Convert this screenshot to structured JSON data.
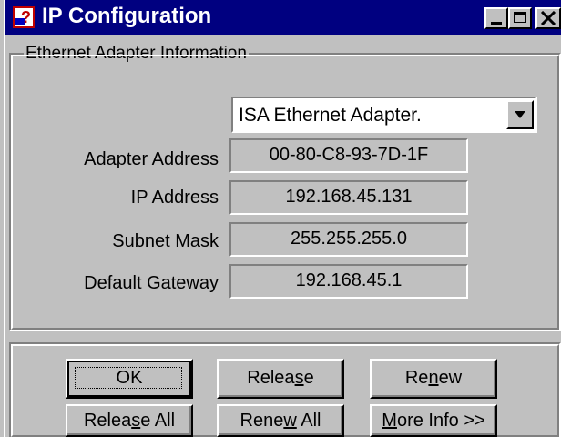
{
  "window": {
    "title": "IP Configuration",
    "icon": "ip-config-app-icon",
    "controls": {
      "minimize": "minimize-icon",
      "maximize": "maximize-icon",
      "close": "close-icon"
    }
  },
  "adapter_group": {
    "legend": "Ethernet  Adapter Information",
    "adapter_select": {
      "selected": "ISA Ethernet Adapter."
    },
    "fields": [
      {
        "label": "Adapter Address",
        "value": "00-80-C8-93-7D-1F"
      },
      {
        "label": "IP Address",
        "value": "192.168.45.131"
      },
      {
        "label": "Subnet Mask",
        "value": "255.255.255.0"
      },
      {
        "label": "Default Gateway",
        "value": "192.168.45.1"
      }
    ]
  },
  "buttons": {
    "ok": "OK",
    "release_pre": "Relea",
    "release_key": "s",
    "release_post": "e",
    "renew_pre": "Re",
    "renew_key": "n",
    "renew_post": "ew",
    "release_all_pre": "Relea",
    "release_all_key": "s",
    "release_all_post": "e All",
    "renew_all_pre": "Rene",
    "renew_all_key": "w",
    "renew_all_post": " All",
    "more_info_key": "M",
    "more_info_post": "ore Info >>"
  },
  "colors": {
    "titlebar": "#000080",
    "face": "#c0c0c0"
  }
}
